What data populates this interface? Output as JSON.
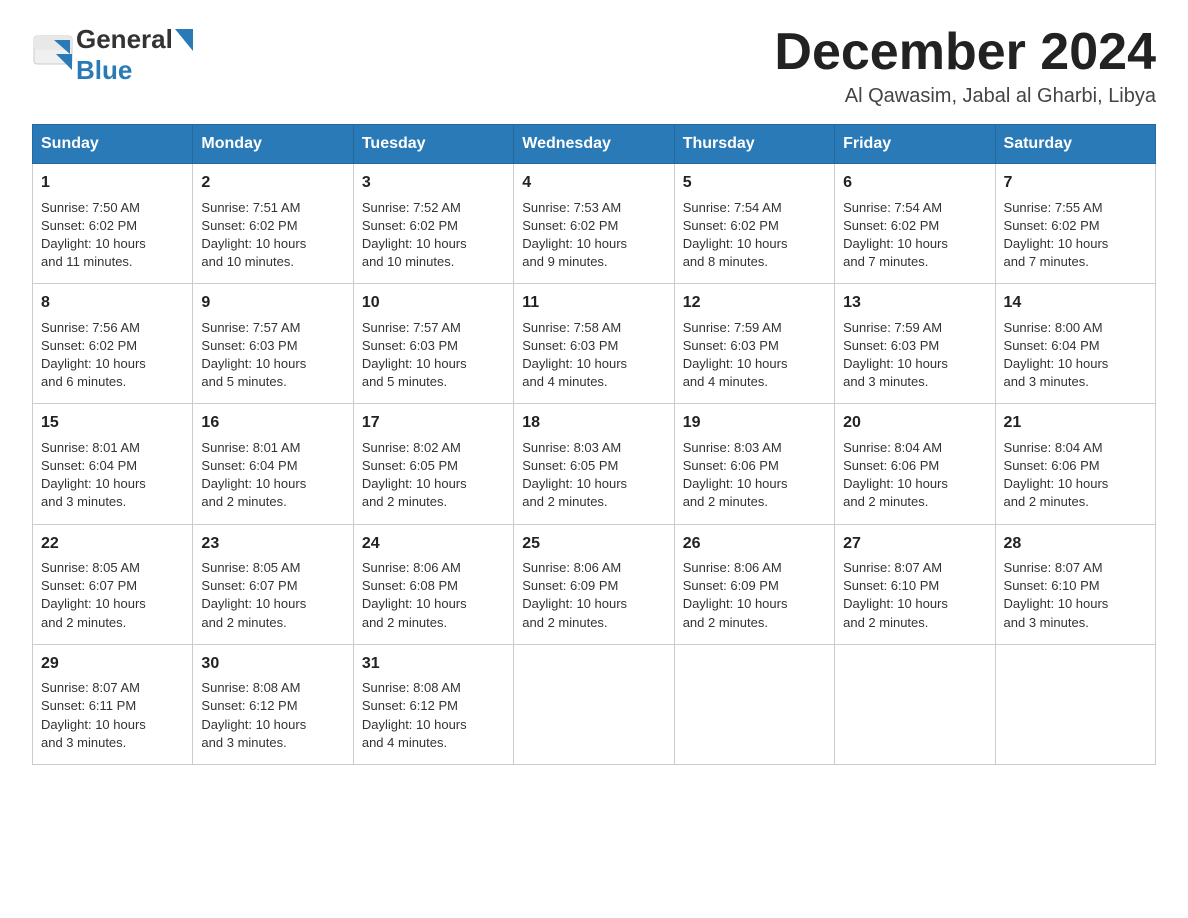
{
  "logo": {
    "general": "General",
    "blue": "Blue"
  },
  "header": {
    "month_year": "December 2024",
    "location": "Al Qawasim, Jabal al Gharbi, Libya"
  },
  "days_of_week": [
    "Sunday",
    "Monday",
    "Tuesday",
    "Wednesday",
    "Thursday",
    "Friday",
    "Saturday"
  ],
  "weeks": [
    [
      {
        "day": "1",
        "sunrise": "7:50 AM",
        "sunset": "6:02 PM",
        "daylight": "10 hours and 11 minutes."
      },
      {
        "day": "2",
        "sunrise": "7:51 AM",
        "sunset": "6:02 PM",
        "daylight": "10 hours and 10 minutes."
      },
      {
        "day": "3",
        "sunrise": "7:52 AM",
        "sunset": "6:02 PM",
        "daylight": "10 hours and 10 minutes."
      },
      {
        "day": "4",
        "sunrise": "7:53 AM",
        "sunset": "6:02 PM",
        "daylight": "10 hours and 9 minutes."
      },
      {
        "day": "5",
        "sunrise": "7:54 AM",
        "sunset": "6:02 PM",
        "daylight": "10 hours and 8 minutes."
      },
      {
        "day": "6",
        "sunrise": "7:54 AM",
        "sunset": "6:02 PM",
        "daylight": "10 hours and 7 minutes."
      },
      {
        "day": "7",
        "sunrise": "7:55 AM",
        "sunset": "6:02 PM",
        "daylight": "10 hours and 7 minutes."
      }
    ],
    [
      {
        "day": "8",
        "sunrise": "7:56 AM",
        "sunset": "6:02 PM",
        "daylight": "10 hours and 6 minutes."
      },
      {
        "day": "9",
        "sunrise": "7:57 AM",
        "sunset": "6:03 PM",
        "daylight": "10 hours and 5 minutes."
      },
      {
        "day": "10",
        "sunrise": "7:57 AM",
        "sunset": "6:03 PM",
        "daylight": "10 hours and 5 minutes."
      },
      {
        "day": "11",
        "sunrise": "7:58 AM",
        "sunset": "6:03 PM",
        "daylight": "10 hours and 4 minutes."
      },
      {
        "day": "12",
        "sunrise": "7:59 AM",
        "sunset": "6:03 PM",
        "daylight": "10 hours and 4 minutes."
      },
      {
        "day": "13",
        "sunrise": "7:59 AM",
        "sunset": "6:03 PM",
        "daylight": "10 hours and 3 minutes."
      },
      {
        "day": "14",
        "sunrise": "8:00 AM",
        "sunset": "6:04 PM",
        "daylight": "10 hours and 3 minutes."
      }
    ],
    [
      {
        "day": "15",
        "sunrise": "8:01 AM",
        "sunset": "6:04 PM",
        "daylight": "10 hours and 3 minutes."
      },
      {
        "day": "16",
        "sunrise": "8:01 AM",
        "sunset": "6:04 PM",
        "daylight": "10 hours and 2 minutes."
      },
      {
        "day": "17",
        "sunrise": "8:02 AM",
        "sunset": "6:05 PM",
        "daylight": "10 hours and 2 minutes."
      },
      {
        "day": "18",
        "sunrise": "8:03 AM",
        "sunset": "6:05 PM",
        "daylight": "10 hours and 2 minutes."
      },
      {
        "day": "19",
        "sunrise": "8:03 AM",
        "sunset": "6:06 PM",
        "daylight": "10 hours and 2 minutes."
      },
      {
        "day": "20",
        "sunrise": "8:04 AM",
        "sunset": "6:06 PM",
        "daylight": "10 hours and 2 minutes."
      },
      {
        "day": "21",
        "sunrise": "8:04 AM",
        "sunset": "6:06 PM",
        "daylight": "10 hours and 2 minutes."
      }
    ],
    [
      {
        "day": "22",
        "sunrise": "8:05 AM",
        "sunset": "6:07 PM",
        "daylight": "10 hours and 2 minutes."
      },
      {
        "day": "23",
        "sunrise": "8:05 AM",
        "sunset": "6:07 PM",
        "daylight": "10 hours and 2 minutes."
      },
      {
        "day": "24",
        "sunrise": "8:06 AM",
        "sunset": "6:08 PM",
        "daylight": "10 hours and 2 minutes."
      },
      {
        "day": "25",
        "sunrise": "8:06 AM",
        "sunset": "6:09 PM",
        "daylight": "10 hours and 2 minutes."
      },
      {
        "day": "26",
        "sunrise": "8:06 AM",
        "sunset": "6:09 PM",
        "daylight": "10 hours and 2 minutes."
      },
      {
        "day": "27",
        "sunrise": "8:07 AM",
        "sunset": "6:10 PM",
        "daylight": "10 hours and 2 minutes."
      },
      {
        "day": "28",
        "sunrise": "8:07 AM",
        "sunset": "6:10 PM",
        "daylight": "10 hours and 3 minutes."
      }
    ],
    [
      {
        "day": "29",
        "sunrise": "8:07 AM",
        "sunset": "6:11 PM",
        "daylight": "10 hours and 3 minutes."
      },
      {
        "day": "30",
        "sunrise": "8:08 AM",
        "sunset": "6:12 PM",
        "daylight": "10 hours and 3 minutes."
      },
      {
        "day": "31",
        "sunrise": "8:08 AM",
        "sunset": "6:12 PM",
        "daylight": "10 hours and 4 minutes."
      },
      null,
      null,
      null,
      null
    ]
  ],
  "labels": {
    "sunrise": "Sunrise:",
    "sunset": "Sunset:",
    "daylight": "Daylight:"
  }
}
